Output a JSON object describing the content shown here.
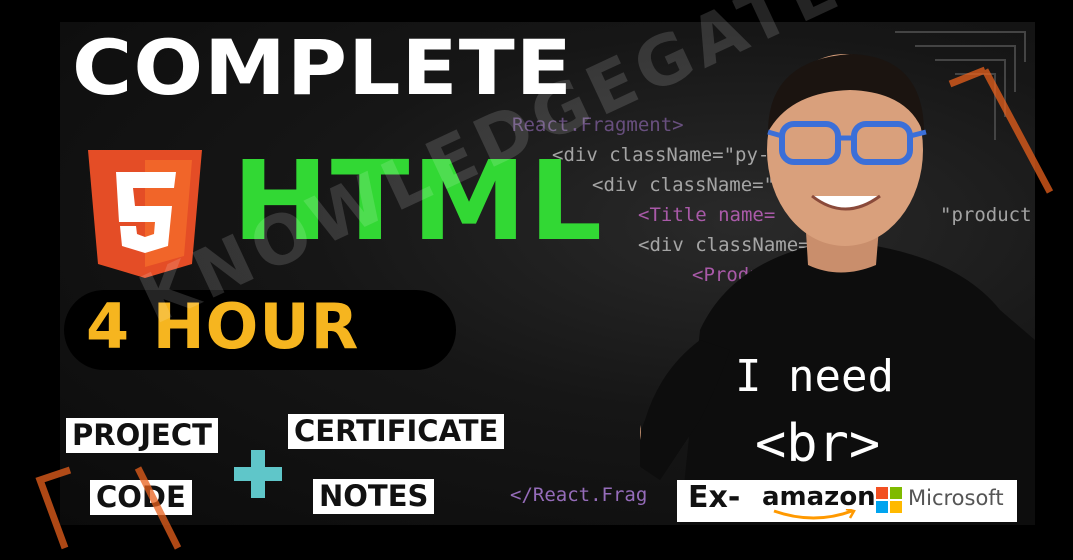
{
  "thumbnail": {
    "headline": "COMPLETE",
    "logo": {
      "number": "5",
      "name": "html5-logo"
    },
    "language": "HTML",
    "duration": "4 HOUR",
    "tags": {
      "project": "PROJECT",
      "certificate": "CERTIFICATE",
      "code": "CODE",
      "notes": "NOTES"
    },
    "plus_icon": "plus-icon",
    "watermark": "KNOWLEDGEGATE",
    "code_lines": [
      "React.Fragment>",
      "<div className=\"py-",
      "<div className=\"",
      "<Title name=",
      "\"product",
      "<div className=",
      "<ProductCo",
      "</",
      "</",
      "</React.Frag"
    ],
    "shirt": {
      "line1": "I need",
      "line2": "<br>"
    },
    "badge": {
      "prefix": "Ex-",
      "company1": "amazon",
      "company2": "Microsoft"
    },
    "colors": {
      "html_green": "#32d834",
      "hour_yellow": "#f6b51f",
      "html5_orange": "#e44d26",
      "plus_teal": "#5fc6c9",
      "frame_orange": "#e8601c",
      "glasses_blue": "#3b6fd8"
    }
  }
}
